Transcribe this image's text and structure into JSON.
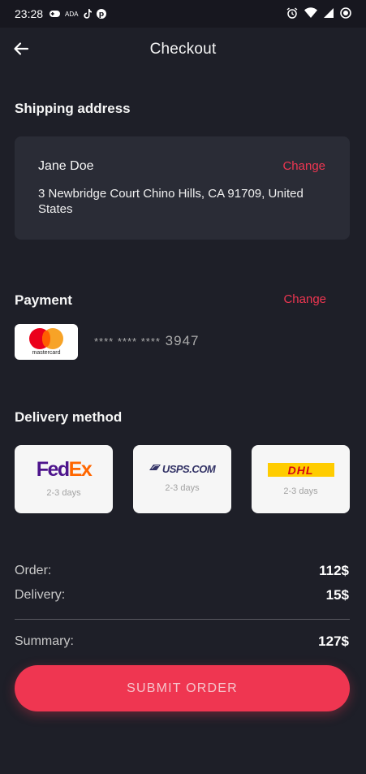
{
  "status_bar": {
    "time": "23:28",
    "notif_text": "ADA"
  },
  "header": {
    "title": "Checkout"
  },
  "shipping": {
    "section_title": "Shipping address",
    "name": "Jane Doe",
    "change_label": "Change",
    "address": "3 Newbridge Court Chino Hills, CA 91709, United States"
  },
  "payment": {
    "section_title": "Payment",
    "change_label": "Change",
    "card_brand": "mastercard",
    "card_mask": "****  ****  ****",
    "card_last4": "3947"
  },
  "delivery": {
    "section_title": "Delivery method",
    "carriers": [
      {
        "name": "FedEx",
        "logo_a": "Fed",
        "logo_b": "Ex",
        "days": "2-3 days"
      },
      {
        "name": "USPS.COM",
        "logo": "USPS.COM",
        "days": "2-3 days"
      },
      {
        "name": "DHL",
        "logo": "DHL",
        "days": "2-3 days"
      }
    ]
  },
  "summary": {
    "order_label": "Order:",
    "order_value": "112$",
    "delivery_label": "Delivery:",
    "delivery_value": "15$",
    "summary_label": "Summary:",
    "summary_value": "127$"
  },
  "submit_label": "SUBMIT ORDER",
  "colors": {
    "accent": "#ef3651",
    "background": "#1e1f28",
    "card": "#2a2c36"
  }
}
